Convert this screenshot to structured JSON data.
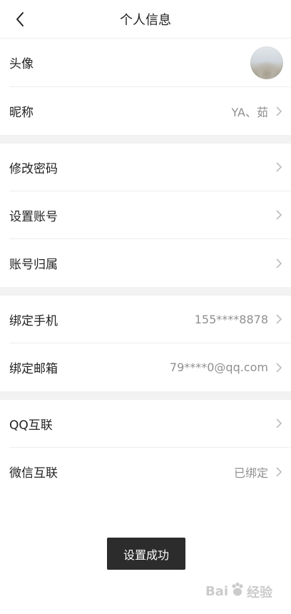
{
  "header": {
    "title": "个人信息",
    "back_icon": "chevron-left-icon"
  },
  "profile": {
    "avatar_label": "头像",
    "nickname_label": "昵称",
    "nickname_value": "YA、茹"
  },
  "account": {
    "change_password_label": "修改密码",
    "set_account_label": "设置账号",
    "account_ownership_label": "账号归属"
  },
  "binding": {
    "phone_label": "绑定手机",
    "phone_value": "155****8878",
    "email_label": "绑定邮箱",
    "email_value": "79****0@qq.com"
  },
  "social": {
    "qq_label": "QQ互联",
    "wechat_label": "微信互联",
    "wechat_value": "已绑定"
  },
  "toast": {
    "message": "设置成功"
  },
  "watermark": {
    "text_left": "Bai",
    "text_right": "经验"
  },
  "colors": {
    "background_gap": "#f2f2f2",
    "value_text": "#8f8f8f",
    "toast_bg": "#2c2c2c"
  }
}
